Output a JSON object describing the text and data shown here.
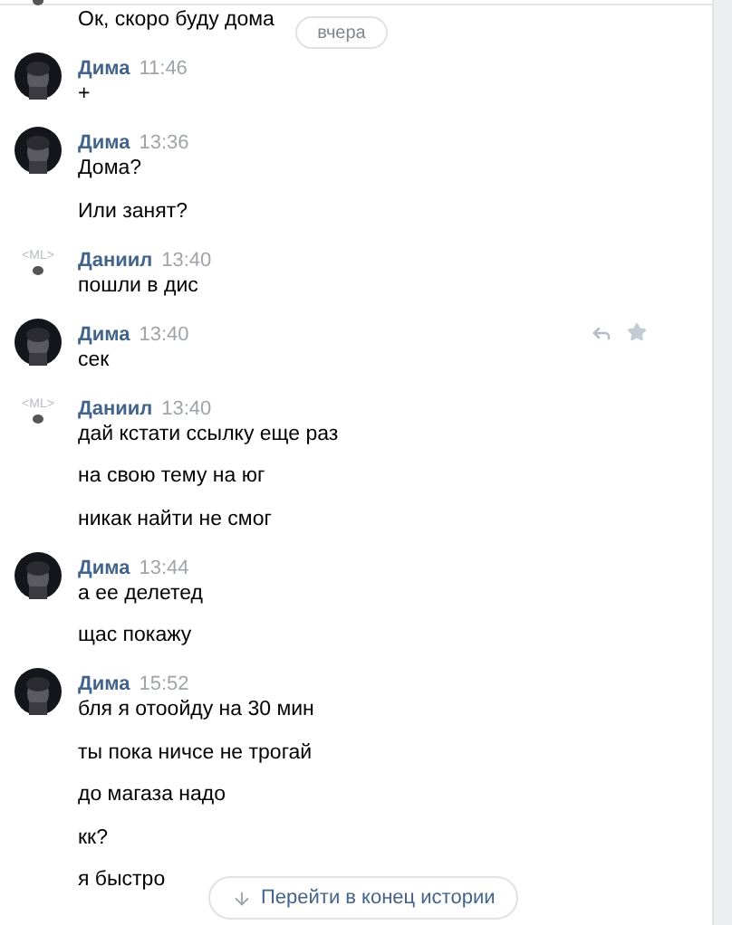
{
  "date_badge": "вчера",
  "groups": [
    {
      "kind": "ml_cut",
      "lines": [
        "Ок, скоро буду дома"
      ]
    },
    {
      "name": "Дима",
      "time": "11:46",
      "lines": [
        "+"
      ]
    },
    {
      "name": "Дима",
      "time": "13:36",
      "lines": [
        "Дома?",
        "Или занят?"
      ]
    },
    {
      "kind": "ml",
      "avatar_text": "<ML>",
      "name": "Даниил",
      "time": "13:40",
      "lines": [
        "пошли в дис"
      ]
    },
    {
      "name": "Дима",
      "time": "13:40",
      "lines": [
        "сек"
      ],
      "actions_visible": true
    },
    {
      "kind": "ml",
      "avatar_text": "<ML>",
      "name": "Даниил",
      "time": "13:40",
      "lines": [
        "дай кстати ссылку еще раз",
        "на свою тему на юг",
        "никак найти не смог"
      ]
    },
    {
      "name": "Дима",
      "time": "13:44",
      "lines": [
        "а ее делетед",
        "щас покажу"
      ]
    },
    {
      "name": "Дима",
      "time": "15:52",
      "lines": [
        "бля я отоойду на 30 мин",
        "ты пока ничсе не трогай",
        "до магаза надо",
        "кк?",
        "я быстро"
      ]
    }
  ],
  "jump_button": "Перейти в конец истории"
}
